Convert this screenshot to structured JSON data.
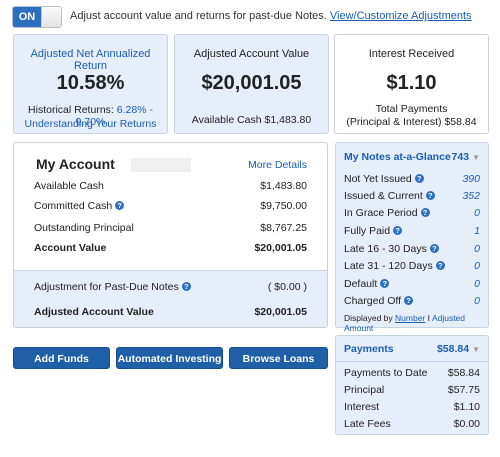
{
  "toggle": {
    "state": "ON",
    "text": "Adjust account value and returns for past-due Notes.",
    "link": "View/Customize Adjustments"
  },
  "summary": {
    "naar": {
      "label": "Adjusted Net Annualized Return",
      "value": "10.58%",
      "hist_label": "Historical Returns:",
      "hist_value": "6.28% - 9.70%",
      "link": "Understanding Your Returns"
    },
    "aav": {
      "label": "Adjusted Account Value",
      "value": "$20,001.05",
      "sub": "Available Cash $1,483.80"
    },
    "interest": {
      "label": "Interest Received",
      "value": "$1.10",
      "sub1": "Total Payments",
      "sub2": "(Principal & Interest) $58.84"
    }
  },
  "account": {
    "title": "My Account",
    "more": "More Details",
    "rows": [
      {
        "label": "Available Cash",
        "value": "$1,483.80",
        "help": false,
        "bold": false
      },
      {
        "label": "Committed Cash",
        "value": "$9,750.00",
        "help": true,
        "bold": false
      },
      {
        "label": "Outstanding Principal",
        "value": "$8,767.25",
        "help": false,
        "bold": false
      },
      {
        "label": "Account Value",
        "value": "$20,001.05",
        "help": false,
        "bold": true
      }
    ],
    "adj_label": "Adjustment for Past-Due Notes",
    "adj_value": "( $0.00 )",
    "adj_total_label": "Adjusted Account Value",
    "adj_total_value": "$20,001.05"
  },
  "buttons": {
    "add_funds": "Add Funds",
    "auto_investing": "Automated Investing",
    "browse_loans": "Browse Loans"
  },
  "glance": {
    "title": "My Notes at-a-Glance",
    "total": "743",
    "rows": [
      {
        "label": "Not Yet Issued",
        "value": "390"
      },
      {
        "label": "Issued & Current",
        "value": "352"
      },
      {
        "label": "In Grace Period",
        "value": "0"
      },
      {
        "label": "Fully Paid",
        "value": "1"
      },
      {
        "label": "Late 16 - 30 Days",
        "value": "0"
      },
      {
        "label": "Late 31 - 120 Days",
        "value": "0"
      },
      {
        "label": "Default",
        "value": "0"
      },
      {
        "label": "Charged Off",
        "value": "0"
      }
    ],
    "footer_prefix": "Displayed by",
    "footer_number": "Number",
    "footer_sep": "I",
    "footer_amount": "Adjusted Amount"
  },
  "payments": {
    "title": "Payments",
    "total": "$58.84",
    "rows": [
      {
        "label": "Payments to Date",
        "value": "$58.84"
      },
      {
        "label": "Principal",
        "value": "$57.75"
      },
      {
        "label": "Interest",
        "value": "$1.10"
      },
      {
        "label": "Late Fees",
        "value": "$0.00"
      }
    ]
  },
  "colors": {
    "accent": "#1e5fa8",
    "link": "#1a5fb4",
    "panel_bg": "#e6eefa",
    "border": "#c5d3e2"
  }
}
